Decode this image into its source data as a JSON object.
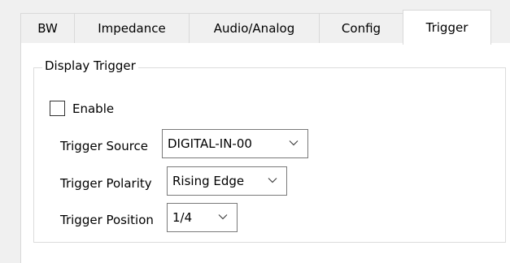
{
  "tabs": [
    {
      "label": "BW",
      "active": false
    },
    {
      "label": "Impedance",
      "active": false
    },
    {
      "label": "Audio/Analog",
      "active": false
    },
    {
      "label": "Config",
      "active": false
    },
    {
      "label": "Trigger",
      "active": true
    }
  ],
  "display_trigger": {
    "group_label": "Display Trigger",
    "enable_label": "Enable",
    "enable_checked": false,
    "source_label": "Trigger Source",
    "source_value": "DIGITAL-IN-00",
    "polarity_label": "Trigger Polarity",
    "polarity_value": "Rising Edge",
    "position_label": "Trigger Position",
    "position_value": "1/4"
  },
  "icons": {
    "dropdown_arrow": "chevron-down-icon"
  },
  "colors": {
    "panel_background": "#ffffff",
    "window_background": "#f0f0f0",
    "border": "#d9d9d9",
    "dropdown_border": "#7a7a7a"
  }
}
